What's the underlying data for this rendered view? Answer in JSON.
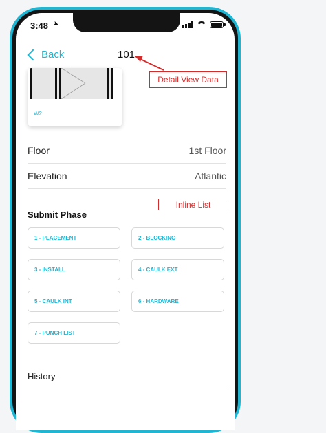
{
  "status_bar": {
    "time": "3:48"
  },
  "nav": {
    "back_label": "Back",
    "title": "101"
  },
  "card": {
    "label": "W2"
  },
  "details": [
    {
      "label": "Floor",
      "value": "1st Floor"
    },
    {
      "label": "Elevation",
      "value": "Atlantic"
    }
  ],
  "submit_phase": {
    "title": "Submit Phase",
    "buttons": [
      "1 - PLACEMENT",
      "2 - BLOCKING",
      "3 - INSTALL",
      "4 - CAULK EXT",
      "5 - CAULK INT",
      "6 - HARDWARE",
      "7 - PUNCH LIST"
    ]
  },
  "history": {
    "label": "History"
  },
  "annotations": {
    "detail_view": "Detail View Data",
    "inline_list": "Inline List"
  },
  "colors": {
    "accent": "#1fb6d3",
    "annotation_red": "#d52b2b"
  }
}
